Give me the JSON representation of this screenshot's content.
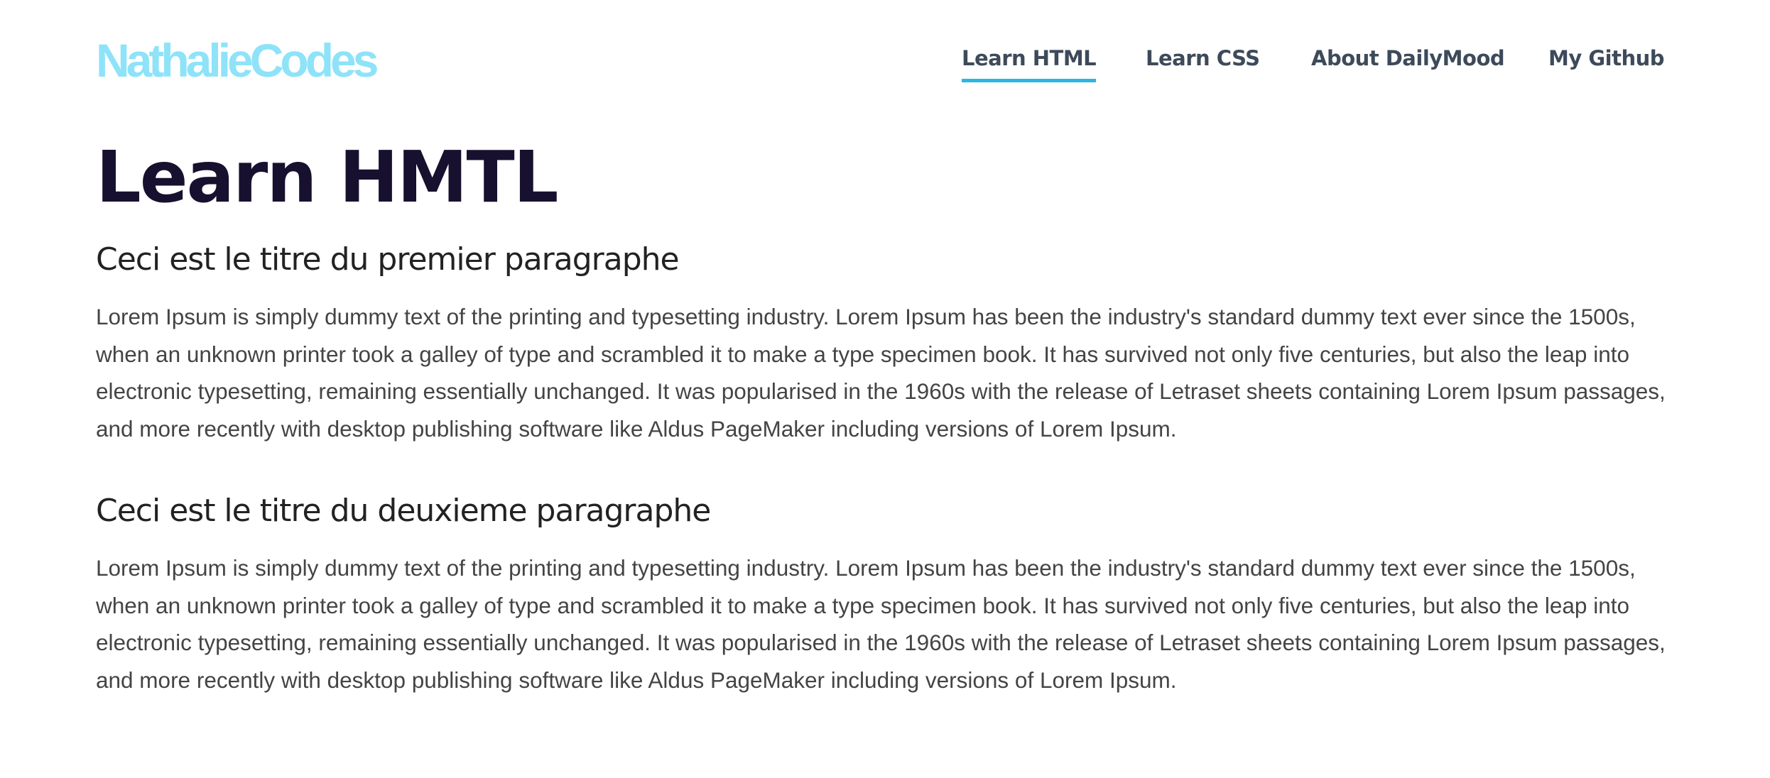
{
  "header": {
    "logo": "NathalieCodes",
    "nav": [
      {
        "label": "Learn HTML",
        "active": true
      },
      {
        "label": "Learn CSS",
        "active": false
      },
      {
        "label": "About DailyMood",
        "active": false
      },
      {
        "label": "My Github",
        "active": false
      }
    ]
  },
  "main": {
    "title": "Learn HMTL",
    "sections": [
      {
        "heading": "Ceci est le titre du premier paragraphe",
        "body": "Lorem Ipsum is simply dummy text of the printing and typesetting industry. Lorem Ipsum has been the industry's standard dummy text ever since the 1500s, when an unknown printer took a galley of type and scrambled it to make a type specimen book. It has survived not only five centuries, but also the leap into electronic typesetting, remaining essentially unchanged. It was popularised in the 1960s with the release of Letraset sheets containing Lorem Ipsum passages, and more recently with desktop publishing software like Aldus PageMaker including versions of Lorem Ipsum."
      },
      {
        "heading": "Ceci est le titre du deuxieme paragraphe",
        "body": "Lorem Ipsum is simply dummy text of the printing and typesetting industry. Lorem Ipsum has been the industry's standard dummy text ever since the 1500s, when an unknown printer took a galley of type and scrambled it to make a type specimen book. It has survived not only five centuries, but also the leap into electronic typesetting, remaining essentially unchanged. It was popularised in the 1960s with the release of Letraset sheets containing Lorem Ipsum passages, and more recently with desktop publishing software like Aldus PageMaker including versions of Lorem Ipsum."
      }
    ]
  },
  "colors": {
    "logo": "#8ee3f8",
    "nav_text": "#3d4a5a",
    "nav_active_underline": "#2bb5e3",
    "title": "#17102e",
    "body_text": "#444444"
  }
}
